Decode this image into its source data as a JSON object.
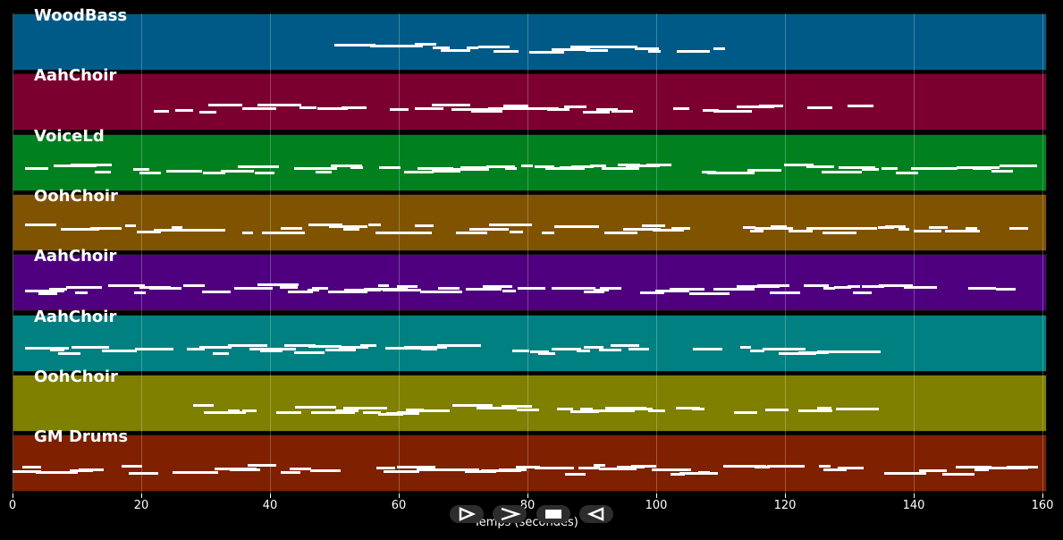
{
  "tracks": [
    {
      "name": "WoodBass",
      "color": "#005a87"
    },
    {
      "name": "AahChoir",
      "color": "#7b0030"
    },
    {
      "name": "VoiceLd",
      "color": "#00801f"
    },
    {
      "name": "OohChoir",
      "color": "#7f5300"
    },
    {
      "name": "AahChoir",
      "color": "#4f007f"
    },
    {
      "name": "AahChoir",
      "color": "#008080"
    },
    {
      "name": "OohChoir",
      "color": "#7f7f00"
    },
    {
      "name": "GM Drums",
      "color": "#7f2000"
    }
  ],
  "axis": {
    "xlabel": "Temps (secondes)",
    "range": [
      0,
      160
    ],
    "ticks": [
      "0",
      "20",
      "40",
      "60",
      "80",
      "100",
      "120",
      "140",
      "160"
    ]
  },
  "controls": [
    {
      "name": "play-icon"
    },
    {
      "name": "fast-forward-icon"
    },
    {
      "name": "stop-icon"
    },
    {
      "name": "rewind-icon"
    }
  ]
}
